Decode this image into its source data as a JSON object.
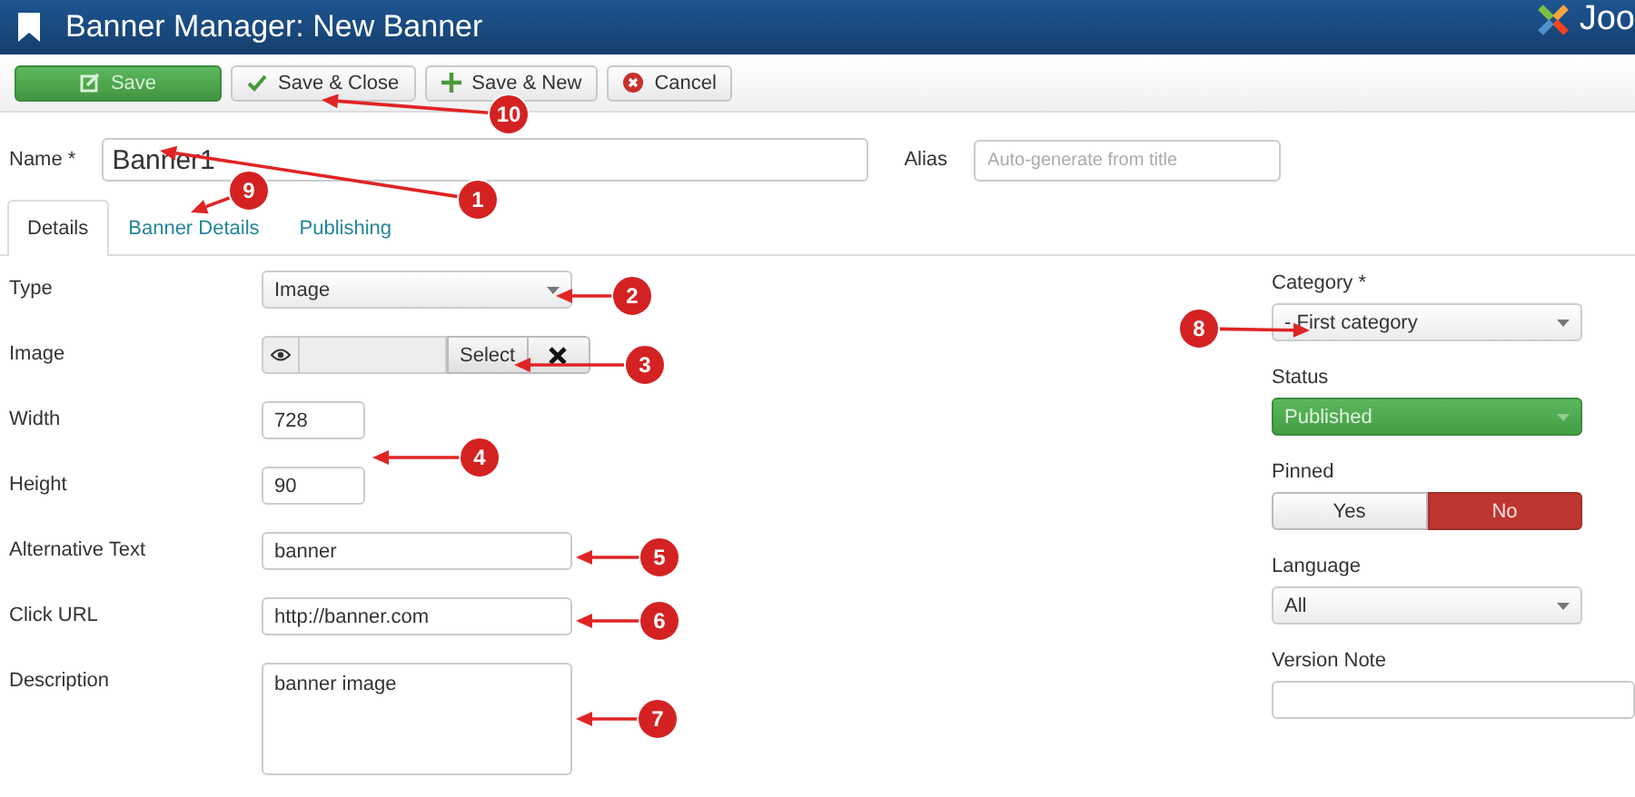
{
  "window": {
    "title": "Banner Manager: New Banner",
    "logo_text": "Joo"
  },
  "toolbar": [
    {
      "label": "Save",
      "kind": "save"
    },
    {
      "label": "Save & Close",
      "kind": "close"
    },
    {
      "label": "Save & New",
      "kind": "new"
    },
    {
      "label": "Cancel",
      "kind": "cancel"
    }
  ],
  "name_field": {
    "label": "Name *",
    "value": "Banner1"
  },
  "alias_field": {
    "label": "Alias",
    "placeholder": "Auto-generate from title"
  },
  "tabs": [
    {
      "label": "Details",
      "selected": true
    },
    {
      "label": "Banner Details",
      "selected": false
    },
    {
      "label": "Publishing",
      "selected": false
    }
  ],
  "fields": [
    {
      "kind": "select",
      "label": "Type",
      "value": "Image"
    },
    {
      "kind": "media",
      "label": "Image",
      "button": "Select"
    },
    {
      "kind": "short",
      "label": "Width",
      "value": "728"
    },
    {
      "kind": "short",
      "label": "Height",
      "value": "90"
    },
    {
      "kind": "text",
      "label": "Alternative Text",
      "value": "banner"
    },
    {
      "kind": "text",
      "label": "Click URL",
      "value": "http://banner.com"
    },
    {
      "kind": "textarea",
      "label": "Description",
      "value": "banner image"
    }
  ],
  "sidebar": [
    {
      "kind": "select",
      "label": "Category *",
      "value": "- First category"
    },
    {
      "kind": "status",
      "label": "Status",
      "value": "Published"
    },
    {
      "kind": "toggle",
      "label": "Pinned",
      "options": [
        {
          "label": "Yes",
          "selected": false
        },
        {
          "label": "No",
          "selected": true
        }
      ]
    },
    {
      "kind": "select",
      "label": "Language",
      "value": "All"
    },
    {
      "kind": "text",
      "label": "Version Note"
    }
  ],
  "callouts": [
    {
      "number": "1"
    },
    {
      "number": "2"
    },
    {
      "number": "3"
    },
    {
      "number": "4"
    },
    {
      "number": "5"
    },
    {
      "number": "6"
    },
    {
      "number": "7"
    },
    {
      "number": "8"
    },
    {
      "number": "9"
    },
    {
      "number": "10"
    }
  ]
}
